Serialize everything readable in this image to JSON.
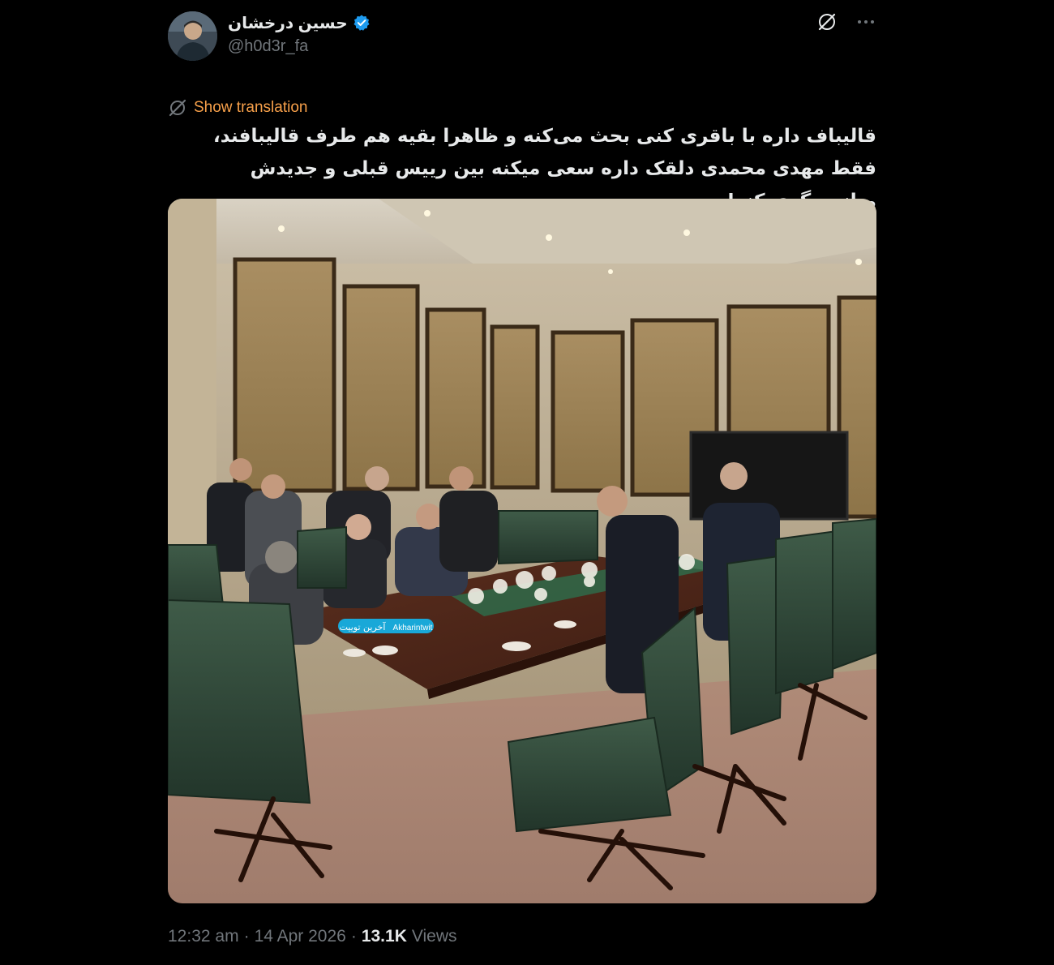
{
  "author": {
    "display_name": "حسین درخشان",
    "handle": "@h0d3r_fa",
    "verified": true,
    "verified_color": "#1d9bf0"
  },
  "header_actions": {
    "grok_icon": "grok-icon",
    "more_icon": "more-icon"
  },
  "translation": {
    "label": "Show translation",
    "icon": "translate-icon",
    "color": "#f7a04a"
  },
  "tweet": {
    "text": "قالیباف داره با باقری کنی بحث می‌کنه و ظاهرا بقیه هم طرف قالیبافند، فقط مهدی محمدی دلقک داره سعی میکنه بین رییس قبلی و جدیدش میانجی‌گری کنه!"
  },
  "media": {
    "type": "photo",
    "watermark_name": "آخرین توییت",
    "watermark_handle": "Akharintwit"
  },
  "meta": {
    "time": "12:32 am",
    "separator": "·",
    "date": "14 Apr 2026",
    "views_count": "13.1K",
    "views_label": "Views"
  }
}
